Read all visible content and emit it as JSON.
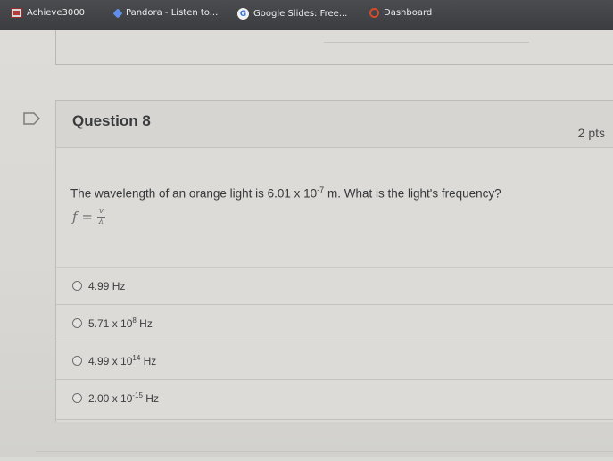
{
  "bookmarks": [
    {
      "label": "Achieve3000",
      "icon": "achieve3000-icon"
    },
    {
      "label": "Pandora - Listen to...",
      "icon": "pandora-icon"
    },
    {
      "label": "Google Slides: Free...",
      "icon": "google-icon"
    },
    {
      "label": "Dashboard",
      "icon": "dashboard-icon"
    }
  ],
  "question": {
    "title": "Question 8",
    "points": "2 pts",
    "text_before": "The wavelength of an orange light is 6.01 x 10",
    "text_exponent": "-7",
    "text_after": " m. What is the light's frequency?",
    "formula": {
      "lhs": "f =",
      "numerator": "v",
      "denominator": "λ"
    }
  },
  "answers": [
    {
      "base": "4.99 Hz",
      "exponent": "",
      "unit": ""
    },
    {
      "base": "5.71 x 10",
      "exponent": "8",
      "unit": " Hz"
    },
    {
      "base": "4.99 x 10",
      "exponent": "14",
      "unit": " Hz"
    },
    {
      "base": "2.00 x 10",
      "exponent": "-15",
      "unit": " Hz"
    }
  ],
  "colors": {
    "bookmarks_bar": "#3f4144",
    "page_background": "#d9d9d6",
    "text": "#37383a"
  }
}
